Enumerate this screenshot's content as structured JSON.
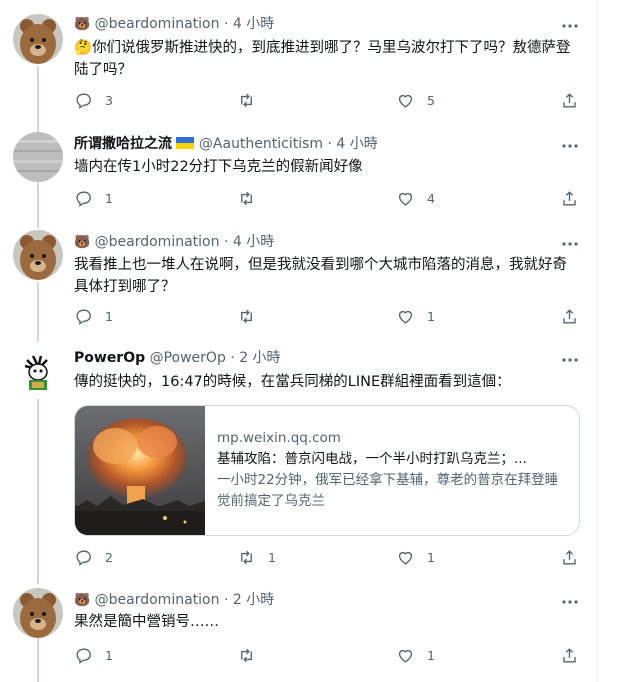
{
  "tweets": [
    {
      "name": "",
      "emoji": "🐻",
      "handle": "@beardomination",
      "dot": "·",
      "time": "4 小時",
      "prefix_emoji": "🤔",
      "text": "你们说俄罗斯推进快的，到底推进到哪了？马里乌波尔打下了吗？敖德萨登陆了吗？",
      "replies": "3",
      "retweets": "",
      "likes": "5"
    },
    {
      "name": "所谓撒哈拉之流",
      "emoji": "",
      "handle": "@Aauthenticitism",
      "dot": "·",
      "time": "4 小時",
      "text": "墙内在传1小时22分打下乌克兰的假新闻好像",
      "replies": "1",
      "retweets": "",
      "likes": "4"
    },
    {
      "name": "",
      "emoji": "🐻",
      "handle": "@beardomination",
      "dot": "·",
      "time": "4 小時",
      "text": "我看推上也一堆人在说啊，但是我就没看到哪个大城市陷落的消息，我就好奇具体打到哪了？",
      "replies": "1",
      "retweets": "",
      "likes": "1"
    },
    {
      "name": "PowerOp",
      "emoji": "",
      "handle": "@PowerOp",
      "dot": "·",
      "time": "2 小時",
      "text": "傳的挺快的，16:47的時候，在當兵同梯的LINE群組裡面看到這個：",
      "card": {
        "domain": "mp.weixin.qq.com",
        "title": "基辅攻陷：普京闪电战，一个半小时打趴乌克兰；...",
        "desc": "一小时22分钟，俄军已经拿下基辅，尊老的普京在拜登睡觉前搞定了乌克兰"
      },
      "replies": "2",
      "retweets": "1",
      "likes": "1"
    },
    {
      "name": "",
      "emoji": "🐻",
      "handle": "@beardomination",
      "dot": "·",
      "time": "2 小時",
      "text": "果然是簡中營销号……",
      "replies": "1",
      "retweets": "",
      "likes": "1"
    }
  ],
  "icons": {
    "reply": "reply-icon",
    "retweet": "retweet-icon",
    "like": "heart-icon",
    "share": "share-icon",
    "more": "more-icon"
  },
  "colors": {
    "text": "#0f1419",
    "muted": "#536471",
    "line": "#cfd9de"
  }
}
